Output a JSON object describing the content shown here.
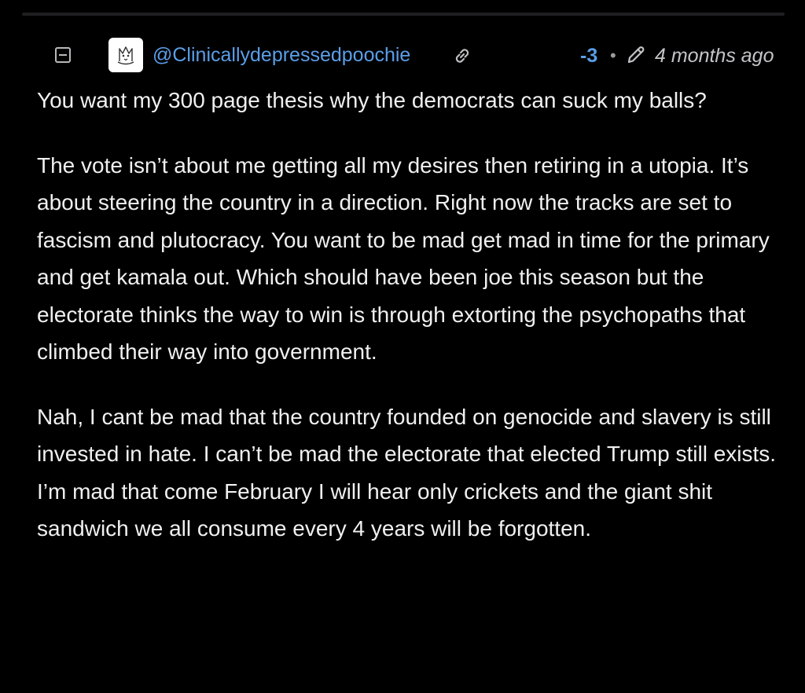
{
  "comment": {
    "username": "@Clinicallydepressedpoochie",
    "score": "-3",
    "separator": "•",
    "timestamp": "4 months ago",
    "icons": {
      "collapse": "collapse-minus-icon",
      "avatar": "dog-sketch-avatar",
      "link": "link-icon",
      "edited": "pencil-edit-icon"
    },
    "colors": {
      "background": "#000000",
      "username": "#5b9ee8",
      "score": "#5b9ee8",
      "body_text": "#f0f0f0",
      "meta_text": "#c4c4c8"
    },
    "paragraphs": [
      "You want my 300 page thesis why the democrats can suck my balls?",
      "The vote isn’t about me getting all my desires then retiring in a utopia. It’s about steering the country in a direction. Right now the tracks are set to fascism and plutocracy. You want to be mad get mad in time for the primary and get kamala out. Which should have been joe this season but the electorate thinks the way to win is through extorting the psychopaths that climbed their way into government.",
      "Nah, I cant be mad that the country founded on genocide and slavery is still invested in hate. I can’t be mad the electorate that elected Trump still exists. I’m mad that come February I will hear only crickets and the giant shit sandwich we all consume every 4 years will be forgotten."
    ]
  }
}
